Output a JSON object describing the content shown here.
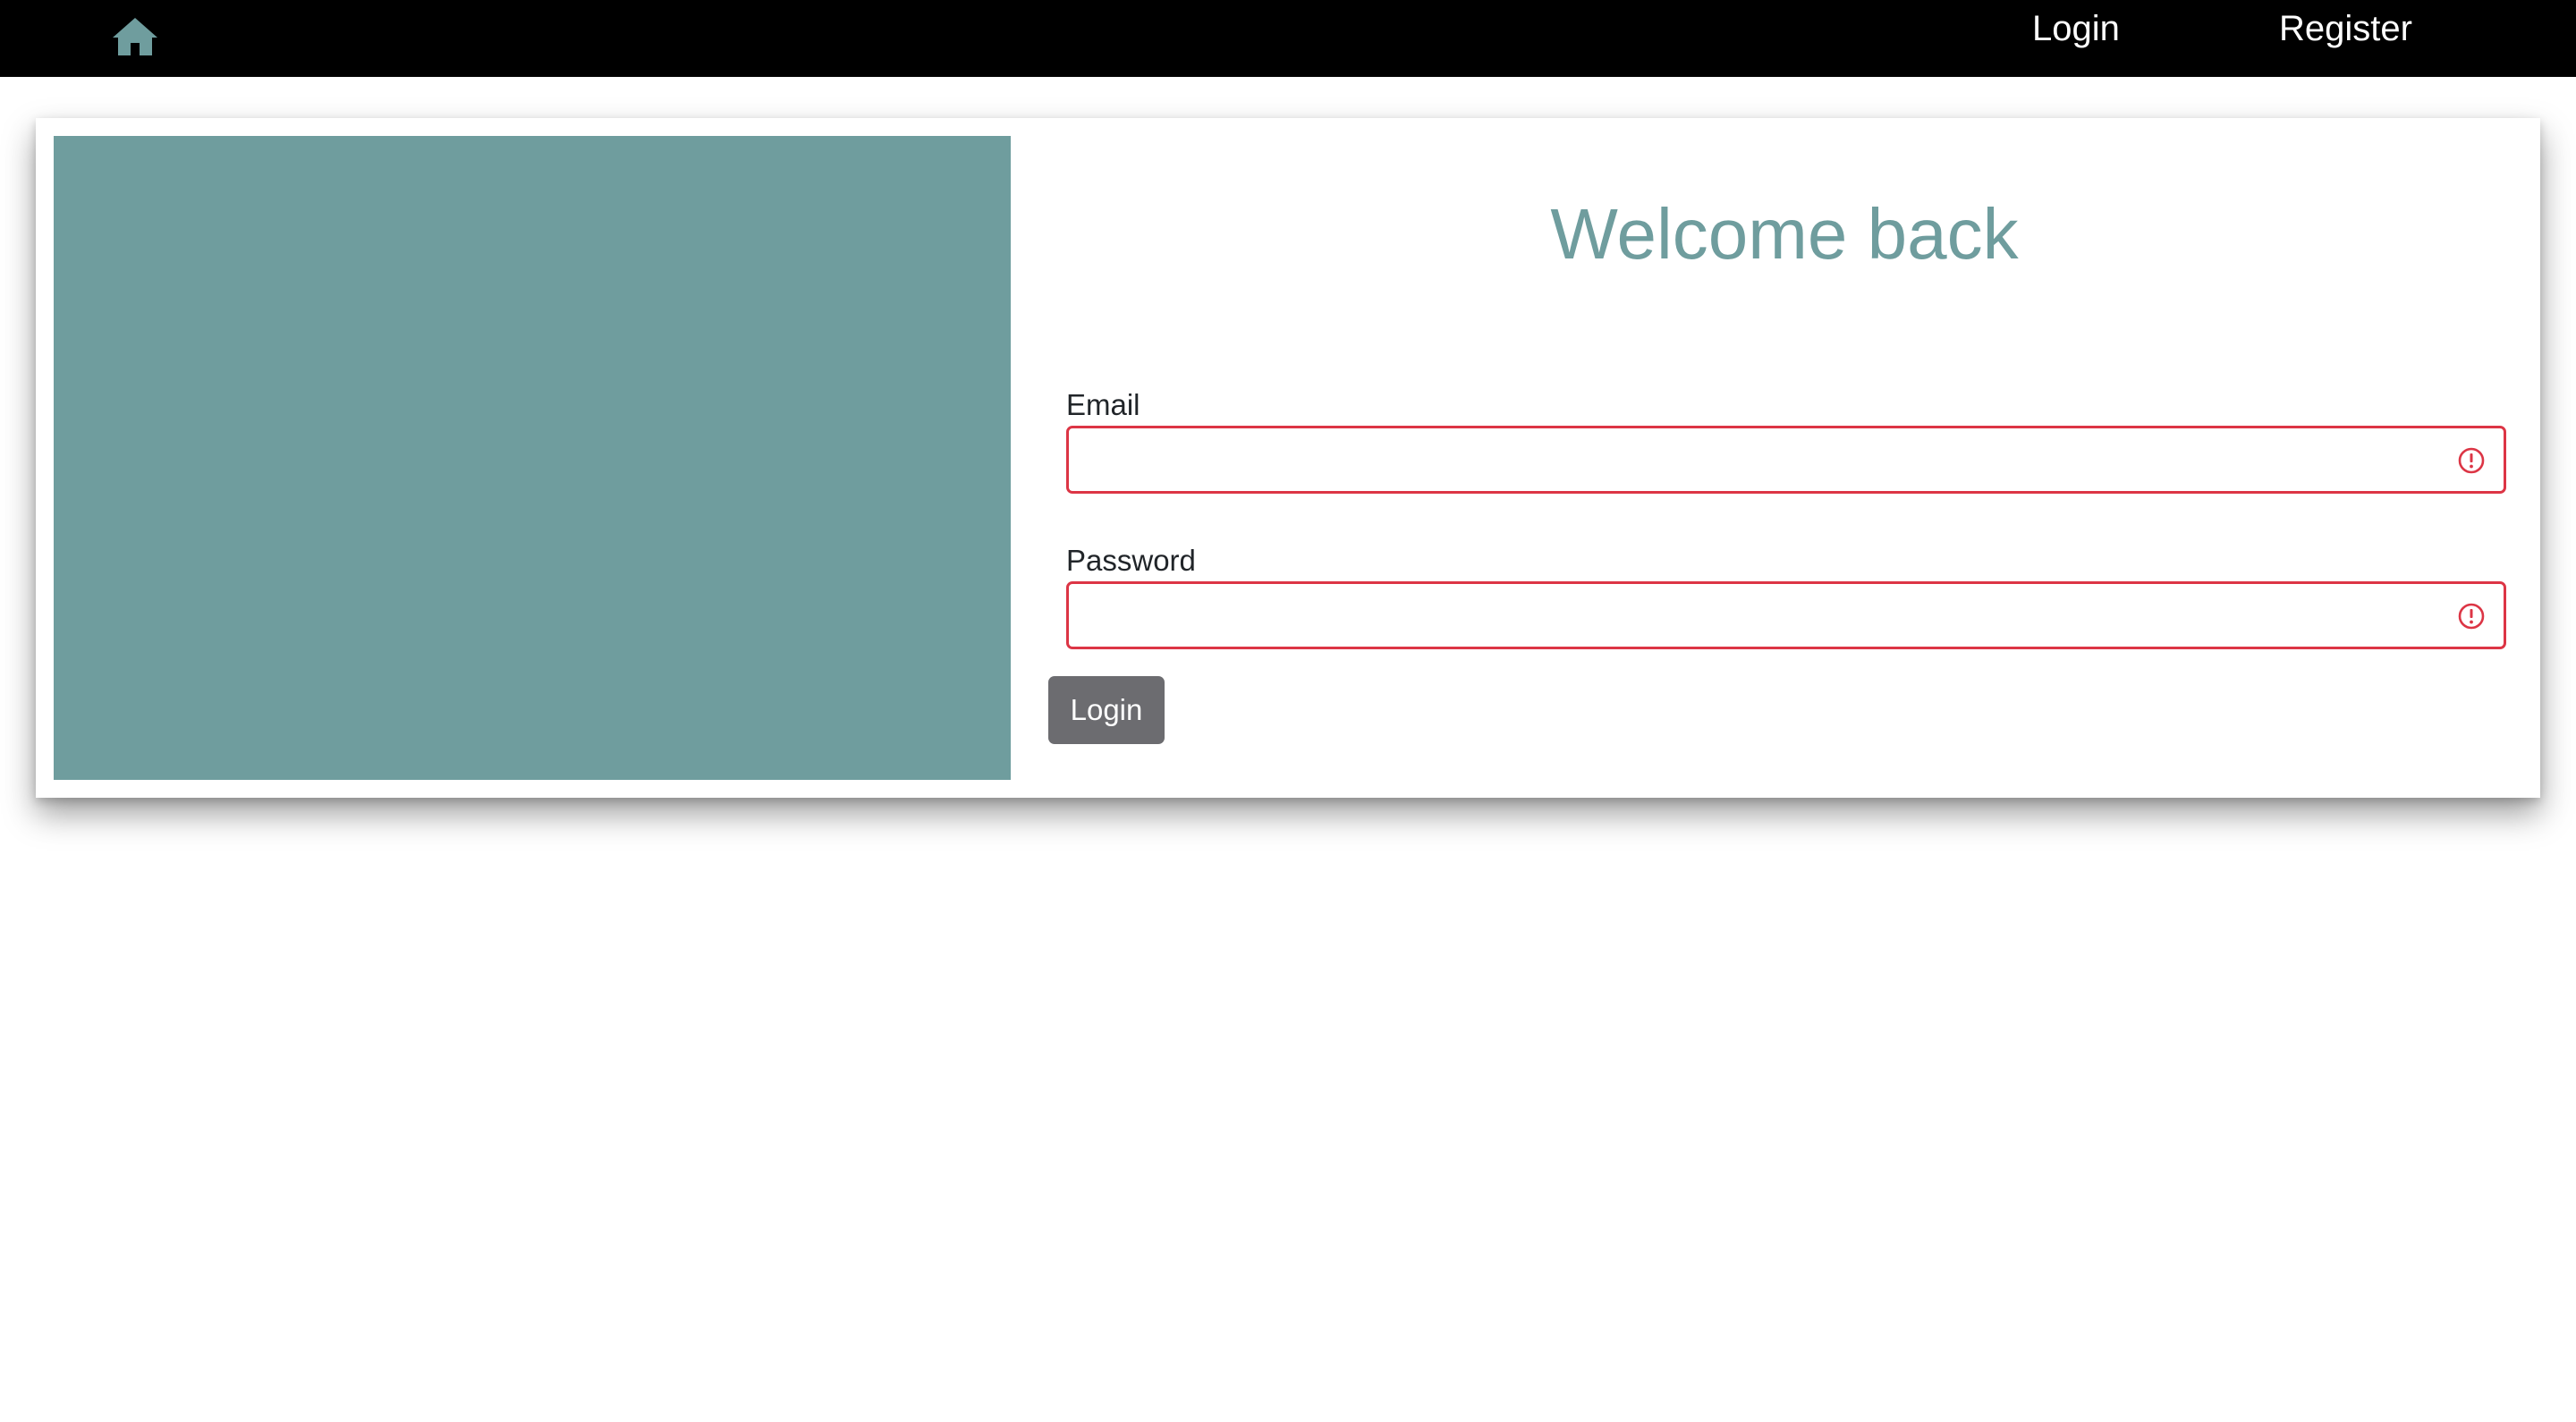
{
  "colors": {
    "navbar_bg": "#000000",
    "accent": "#6f9d9e",
    "invalid": "#dc3545",
    "button_bg": "#6c6c70",
    "text": "#212529"
  },
  "navbar": {
    "home_icon": "home-icon",
    "login_label": "Login",
    "register_label": "Register"
  },
  "card": {
    "title": "Welcome back",
    "email": {
      "label": "Email",
      "value": "",
      "state": "invalid",
      "icon": "alert-circle-icon"
    },
    "password": {
      "label": "Password",
      "value": "",
      "state": "invalid",
      "icon": "alert-circle-icon"
    },
    "login_button_label": "Login"
  }
}
